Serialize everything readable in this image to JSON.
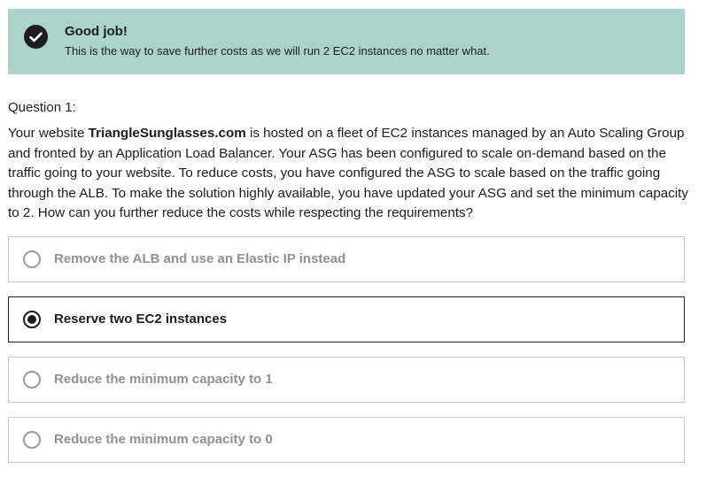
{
  "feedback": {
    "icon": "check-circle-icon",
    "title": "Good job!",
    "message": "This is the way to save further costs as we will run 2 EC2 instances no matter what.",
    "background_color": "#acd2cc"
  },
  "question": {
    "number_label": "Question 1:",
    "text_before": "Your website ",
    "text_bold": "TriangleSunglasses.com",
    "text_after": " is hosted on a fleet of EC2 instances managed by an Auto Scaling Group and fronted by an Application Load Balancer. Your ASG has been configured to scale on-demand based on the traffic going to your website. To reduce costs, you have configured the ASG to scale based on the traffic going through the ALB. To make the solution highly available, you have updated your ASG and set the minimum capacity to 2. How can you further reduce the costs while respecting the requirements?"
  },
  "options": [
    {
      "label": "Remove the ALB and use an Elastic IP instead",
      "selected": false
    },
    {
      "label": "Reserve two EC2 instances",
      "selected": true
    },
    {
      "label": "Reduce the minimum capacity to 1",
      "selected": false
    },
    {
      "label": "Reduce the minimum capacity to 0",
      "selected": false
    }
  ]
}
